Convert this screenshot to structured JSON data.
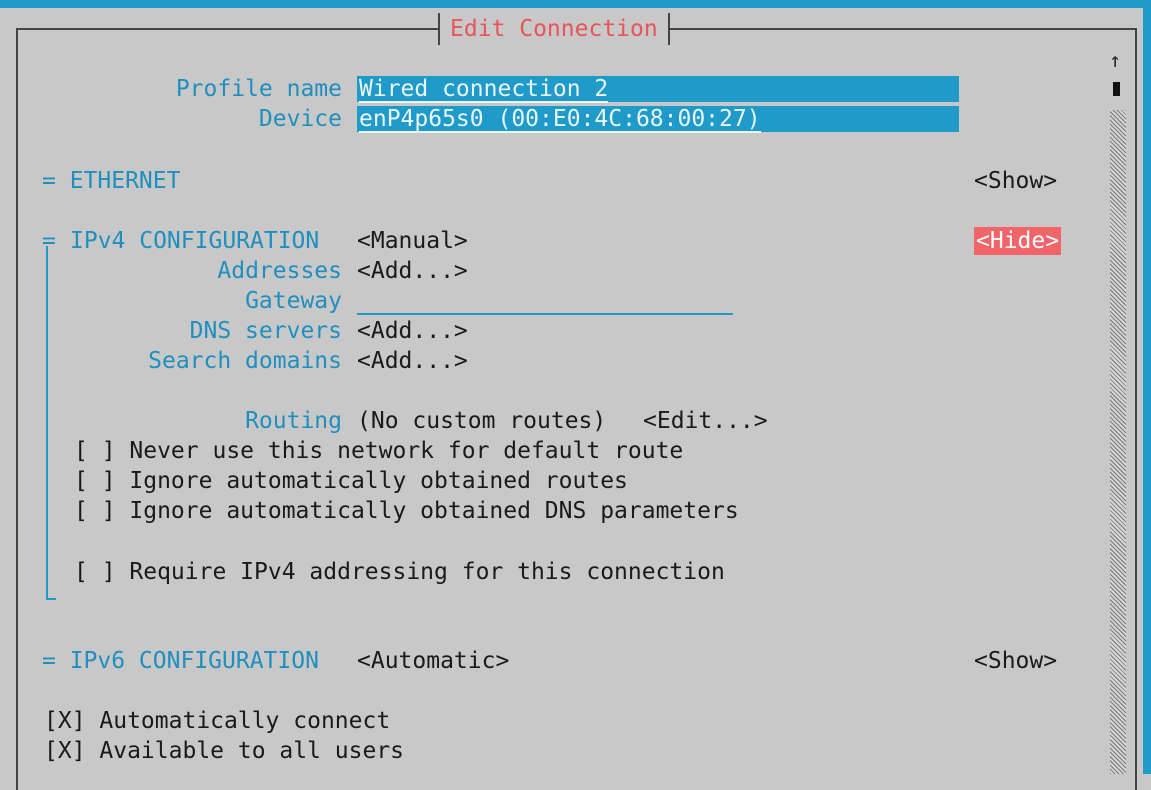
{
  "dialog": {
    "title": "Edit Connection"
  },
  "profile": {
    "profile_name_label": "Profile name",
    "profile_name_value": "Wired connection 2",
    "device_label": "Device",
    "device_value": "enP4p65s0 (00:E0:4C:68:00:27)"
  },
  "ethernet": {
    "heading": "= ETHERNET",
    "toggle": "<Show>"
  },
  "ipv4": {
    "heading": "IPv4 CONFIGURATION",
    "method": "<Manual>",
    "toggle": "<Hide>",
    "addresses_label": "Addresses",
    "addresses_btn": "<Add...>",
    "gateway_label": "Gateway",
    "gateway_value": "",
    "dns_label": "DNS servers",
    "dns_btn": "<Add...>",
    "search_label": "Search domains",
    "search_btn": "<Add...>",
    "routing_label": "Routing",
    "routing_value": "(No custom routes)",
    "routing_btn": "<Edit...>",
    "checks": [
      "[ ] Never use this network for default route",
      "[ ] Ignore automatically obtained routes",
      "[ ] Ignore automatically obtained DNS parameters",
      "[ ] Require IPv4 addressing for this connection"
    ]
  },
  "ipv6": {
    "heading": "= IPv6 CONFIGURATION",
    "method": "<Automatic>",
    "toggle": "<Show>"
  },
  "general": {
    "autoconnect": "[X] Automatically connect",
    "all_users": "[X] Available to all users"
  },
  "scrollbar": {
    "up_arrow": "↑"
  }
}
